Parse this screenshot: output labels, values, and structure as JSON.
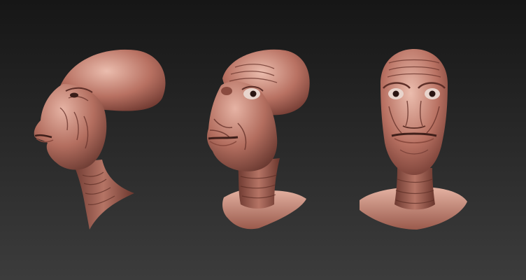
{
  "scene": {
    "background_top": "#161616",
    "background_bottom": "#3c3c3c",
    "clay_light": "#e6b3a4",
    "clay_mid": "#b36e5f",
    "clay_dark": "#5a2e27"
  },
  "views": [
    {
      "name": "side-view"
    },
    {
      "name": "three-quarter-view"
    },
    {
      "name": "front-view"
    }
  ]
}
